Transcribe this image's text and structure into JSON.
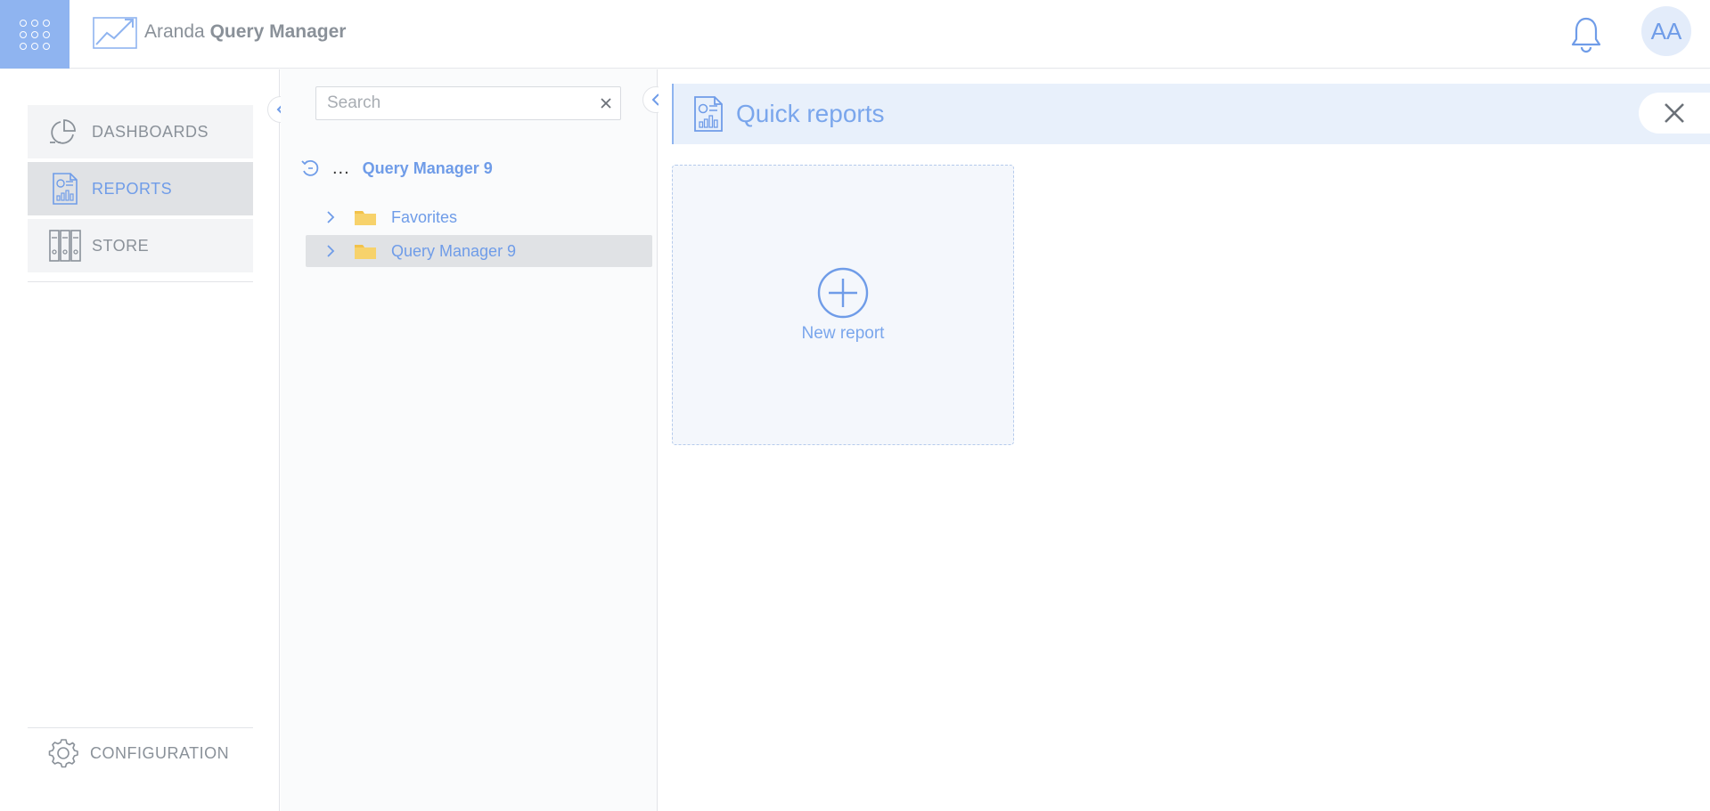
{
  "app": {
    "brand_light": "Aranda",
    "brand_bold": "Query Manager",
    "avatar_initials": "AA"
  },
  "nav": {
    "dashboards": "DASHBOARDS",
    "reports": "REPORTS",
    "store": "STORE",
    "configuration": "CONFIGURATION",
    "active": "reports"
  },
  "tree": {
    "search_placeholder": "Search",
    "search_value": "",
    "root_dots": "...",
    "root_label": "Query Manager 9",
    "items": [
      {
        "label": "Favorites",
        "selected": false
      },
      {
        "label": "Query Manager 9",
        "selected": true
      }
    ]
  },
  "main": {
    "title": "Quick reports",
    "new_report_label": "New report"
  },
  "colors": {
    "accent": "#6f9ce8",
    "apps_button": "#8fb4f0",
    "header_bg": "#e8f0fb",
    "folder": "#f7d26b",
    "muted_text": "#8a9199"
  }
}
